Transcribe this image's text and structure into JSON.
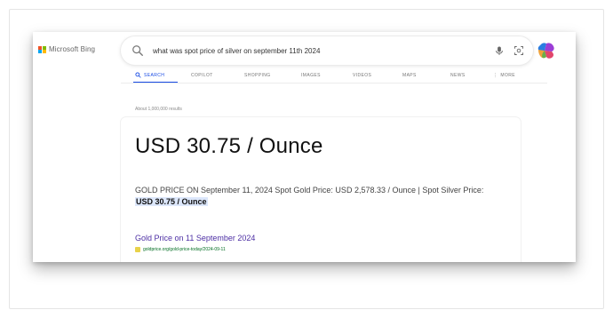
{
  "header": {
    "brand": "Microsoft Bing",
    "search": {
      "query": "what was spot price of silver on september 11th 2024"
    },
    "icons": {
      "search": "search-icon",
      "mic": "microphone-icon",
      "visual_search": "visual-search-icon",
      "copilot": "copilot-icon"
    }
  },
  "tabs": [
    {
      "label": "Search",
      "active": true
    },
    {
      "label": "Copilot",
      "active": false
    },
    {
      "label": "Shopping",
      "active": false
    },
    {
      "label": "Images",
      "active": false
    },
    {
      "label": "Videos",
      "active": false
    },
    {
      "label": "Maps",
      "active": false
    },
    {
      "label": "News",
      "active": false
    },
    {
      "label": "More",
      "active": false
    }
  ],
  "results": {
    "count_text": "About 1,000,000 results",
    "answer": "USD 30.75 / Ounce",
    "snippet_prefix": "GOLD PRICE ON September 11, 2024 Spot Gold Price: USD 2,578.33 / Ounce | Spot Silver Price:",
    "snippet_highlight": "USD 30.75 / Ounce",
    "link_title": "Gold Price on 11 September 2024",
    "link_url": "goldprice.org/gold-price-today/2024-09-11"
  },
  "colors": {
    "active_tab": "#174ae4",
    "link": "#4d2fa4",
    "url": "#006d21",
    "highlight": "#dce7fb"
  }
}
